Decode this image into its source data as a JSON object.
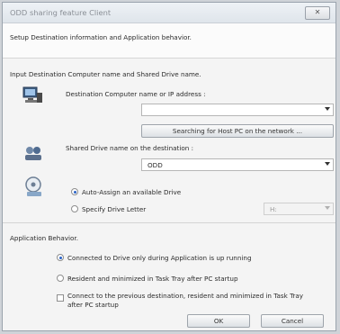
{
  "window": {
    "title": "ODD sharing feature Client",
    "close_icon": "close-icon",
    "close_glyph": "✕"
  },
  "header": {
    "text": "Setup Destination information and Application behavior."
  },
  "input_section": {
    "title": "Input Destination Computer name and Shared Drive name.",
    "computer_label": "Destination Computer name or IP address :",
    "computer_value": "",
    "search_button": "Searching for Host PC on the network ...",
    "share_label": "Shared Drive name on the destination :",
    "share_value": "ODD",
    "auto_assign": "Auto-Assign an available Drive",
    "specify_letter": "Specify Drive Letter",
    "drive_letter": "H:"
  },
  "app_section": {
    "title": "Application Behavior.",
    "opt1": "Connected to Drive only during Application is up running",
    "opt2": "Resident and minimized in Task Tray after PC startup",
    "opt3_line1": "Connect to the previous destination, resident and minimized in Task Tray",
    "opt3_line2": "after PC startup"
  },
  "buttons": {
    "ok": "OK",
    "cancel": "Cancel"
  },
  "icons": [
    "computer-icon",
    "shared-drive-icon",
    "drive-letter-icon"
  ]
}
